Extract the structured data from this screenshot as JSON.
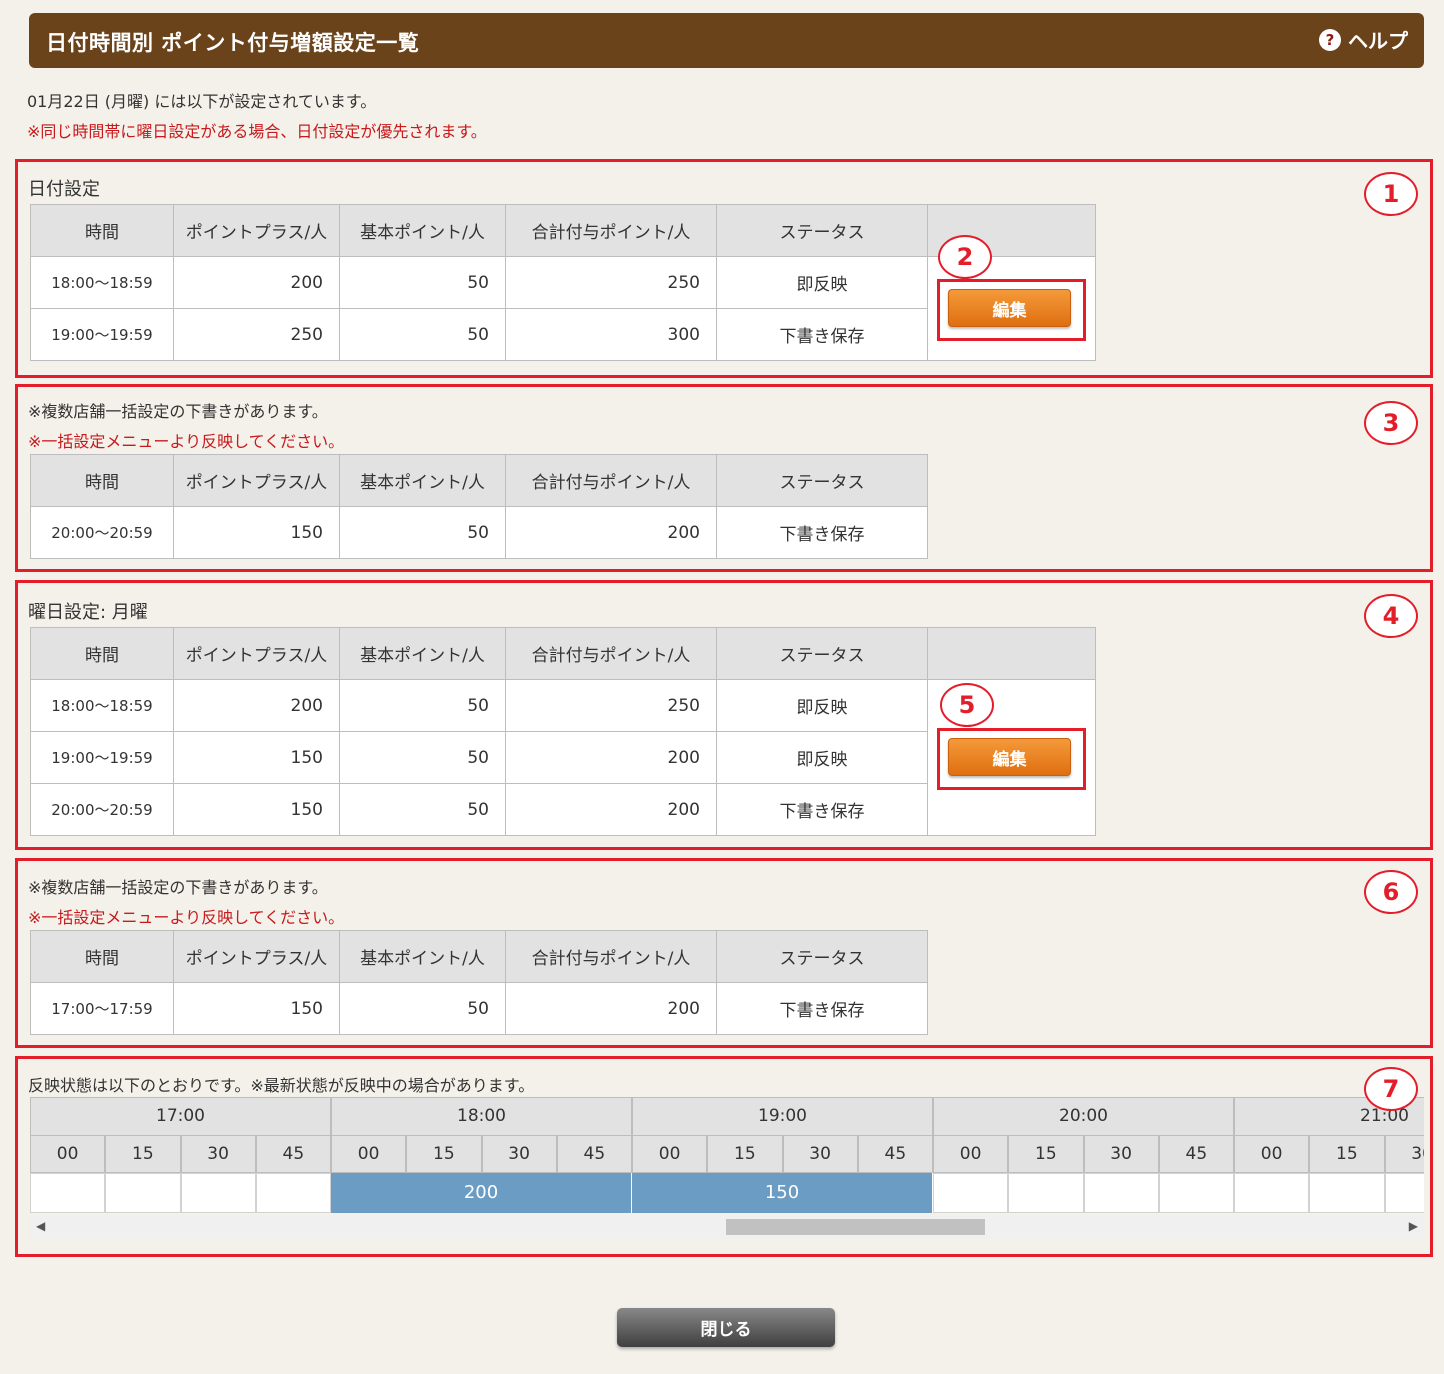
{
  "header": {
    "title": "日付時間別 ポイント付与増額設定一覧",
    "help": "ヘルプ",
    "help_icon": "?"
  },
  "intro": {
    "date_line": "01月22日 (月曜) には以下が設定されています。",
    "priority_note": "※同じ時間帯に曜日設定がある場合、日付設定が優先されます。"
  },
  "columns": [
    "時間",
    "ポイントプラス/人",
    "基本ポイント/人",
    "合計付与ポイント/人",
    "ステータス"
  ],
  "date_setting": {
    "label": "日付設定",
    "number": "1",
    "edit_number": "2",
    "edit_label": "編集",
    "rows": [
      {
        "time": "18:00〜18:59",
        "plus": "200",
        "base": "50",
        "total": "250",
        "status": "即反映"
      },
      {
        "time": "19:00〜19:59",
        "plus": "250",
        "base": "50",
        "total": "300",
        "status": "下書き保存"
      }
    ]
  },
  "date_draft": {
    "number": "3",
    "note": "※複数店舗一括設定の下書きがあります。",
    "warn": "※一括設定メニューより反映してください。",
    "rows": [
      {
        "time": "20:00〜20:59",
        "plus": "150",
        "base": "50",
        "total": "200",
        "status": "下書き保存"
      }
    ]
  },
  "weekday_setting": {
    "label": "曜日設定: 月曜",
    "number": "4",
    "edit_number": "5",
    "edit_label": "編集",
    "rows": [
      {
        "time": "18:00〜18:59",
        "plus": "200",
        "base": "50",
        "total": "250",
        "status": "即反映"
      },
      {
        "time": "19:00〜19:59",
        "plus": "150",
        "base": "50",
        "total": "200",
        "status": "即反映"
      },
      {
        "time": "20:00〜20:59",
        "plus": "150",
        "base": "50",
        "total": "200",
        "status": "下書き保存"
      }
    ]
  },
  "weekday_draft": {
    "number": "6",
    "note": "※複数店舗一括設定の下書きがあります。",
    "warn": "※一括設定メニューより反映してください。",
    "rows": [
      {
        "time": "17:00〜17:59",
        "plus": "150",
        "base": "50",
        "total": "200",
        "status": "下書き保存"
      }
    ]
  },
  "timeline": {
    "number": "7",
    "note": "反映状態は以下のとおりです。※最新状態が反映中の場合があります。",
    "hours": [
      "17:00",
      "18:00",
      "19:00",
      "20:00",
      "21:00"
    ],
    "quarters": [
      "00",
      "15",
      "30",
      "45"
    ],
    "bars": [
      {
        "hour": "18:00",
        "value": "200"
      },
      {
        "hour": "19:00",
        "value": "150"
      }
    ],
    "scroll": {
      "left_arrow": "◀",
      "right_arrow": "▶"
    }
  },
  "close_label": "閉じる",
  "colors": {
    "header_bg": "#6b431b",
    "highlight": "#e31e2a",
    "button": "#e8801f",
    "bar": "#6b9dc4",
    "warn_text": "#c8191c"
  }
}
